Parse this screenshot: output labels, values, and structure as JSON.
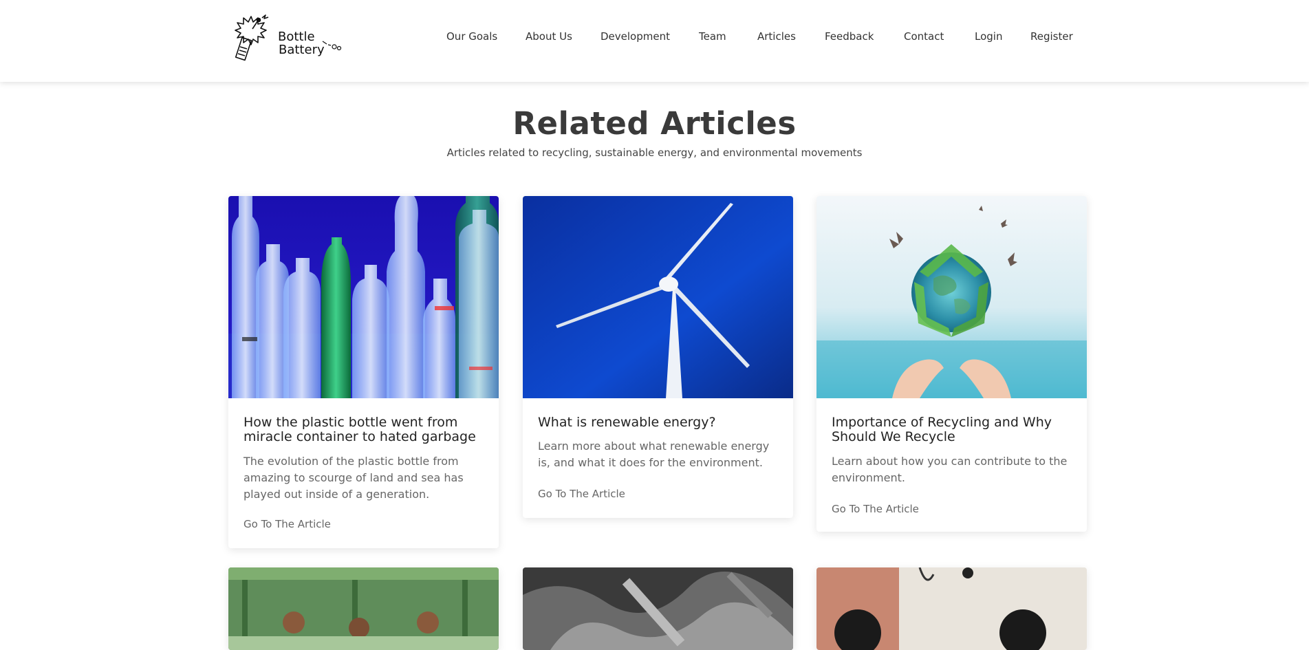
{
  "logo": {
    "line1": "Bottle",
    "line2": "Battery"
  },
  "nav": {
    "items": [
      "Our Goals",
      "About Us",
      "Development",
      "Team",
      "Articles",
      "Feedback",
      "Contact",
      "Login",
      "Register"
    ]
  },
  "section": {
    "title": "Related Articles",
    "subtitle": "Articles related to recycling, sustainable energy, and environmental movements"
  },
  "articles": [
    {
      "title_line1": "How the plastic bottle went from",
      "title_line2": "miracle container to hated garbage",
      "desc_line1": "The evolution of the plastic bottle from",
      "desc_line2": "amazing to scourge of land and sea has",
      "desc_line3": "played out inside of a generation.",
      "link": "Go To The Article",
      "image": "plastic-bottles-photo"
    },
    {
      "title_line1": "What is renewable energy?",
      "title_line2": "",
      "desc_line1": "Learn more about what renewable energy",
      "desc_line2": "is, and what it does for the environment.",
      "desc_line3": "",
      "link": "Go To The Article",
      "image": "wind-turbine-photo"
    },
    {
      "title_line1": "Importance of Recycling and Why",
      "title_line2": "Should We Recycle",
      "desc_line1": "Learn about how you can contribute to the",
      "desc_line2": "environment.",
      "desc_line3": "",
      "link": "Go To The Article",
      "image": "recycling-earth-photo"
    }
  ],
  "colors": {
    "text_dark": "#3a3a3a",
    "text_muted": "#666666",
    "background": "#ffffff"
  }
}
